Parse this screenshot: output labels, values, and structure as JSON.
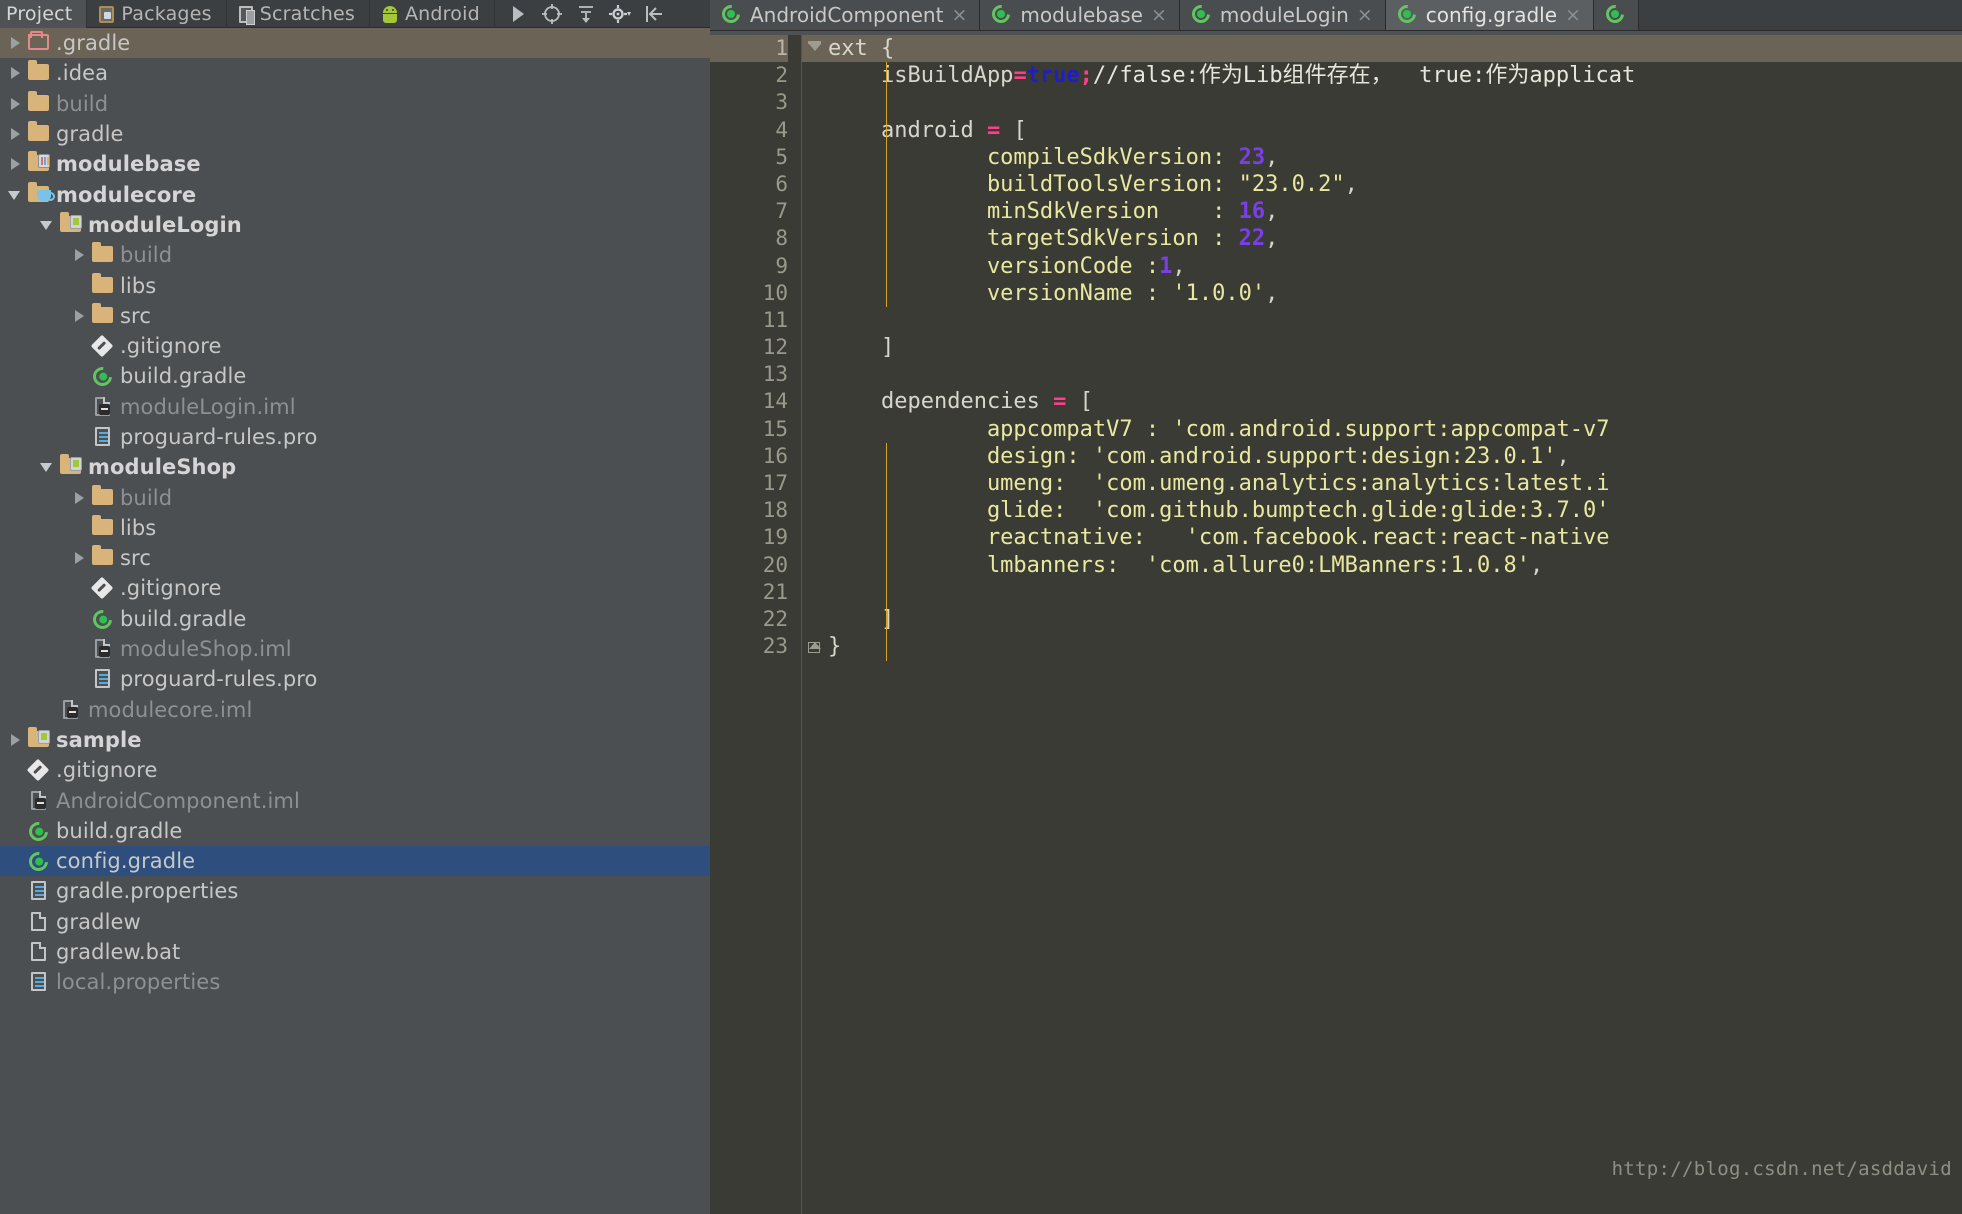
{
  "toolbar": {
    "buttons": [
      {
        "label": "Project",
        "icon": "project-icon",
        "active": true
      },
      {
        "label": "Packages",
        "icon": "packages-icon",
        "active": false
      },
      {
        "label": "Scratches",
        "icon": "scratches-icon",
        "active": false
      },
      {
        "label": "Android",
        "icon": "android-icon",
        "active": false
      }
    ],
    "icons": [
      "play-icon",
      "locate-icon",
      "collapse-all-icon",
      "gear-icon",
      "hide-panel-icon"
    ]
  },
  "tree": {
    "items": [
      {
        "label": ".gradle",
        "indent": 0,
        "arrow": "closed",
        "icon": "folder-hollow-pink",
        "style": "highlight"
      },
      {
        "label": ".idea",
        "indent": 0,
        "arrow": "closed",
        "icon": "folder",
        "style": "normal"
      },
      {
        "label": "build",
        "indent": 0,
        "arrow": "closed",
        "icon": "folder",
        "style": "dim"
      },
      {
        "label": "gradle",
        "indent": 0,
        "arrow": "closed",
        "icon": "folder",
        "style": "normal"
      },
      {
        "label": "modulebase",
        "indent": 0,
        "arrow": "closed",
        "icon": "module-lib",
        "style": "bold"
      },
      {
        "label": "modulecore",
        "indent": 0,
        "arrow": "open",
        "icon": "module-java",
        "style": "bold"
      },
      {
        "label": "moduleLogin",
        "indent": 1,
        "arrow": "open",
        "icon": "module-android",
        "style": "bold"
      },
      {
        "label": "build",
        "indent": 2,
        "arrow": "closed",
        "icon": "folder",
        "style": "dim"
      },
      {
        "label": "libs",
        "indent": 2,
        "arrow": "none",
        "icon": "folder",
        "style": "normal"
      },
      {
        "label": "src",
        "indent": 2,
        "arrow": "closed",
        "icon": "folder",
        "style": "normal"
      },
      {
        "label": ".gitignore",
        "indent": 2,
        "arrow": "none",
        "icon": "git",
        "style": "normal"
      },
      {
        "label": "build.gradle",
        "indent": 2,
        "arrow": "none",
        "icon": "gradle",
        "style": "normal"
      },
      {
        "label": "moduleLogin.iml",
        "indent": 2,
        "arrow": "none",
        "icon": "iml",
        "style": "dim"
      },
      {
        "label": "proguard-rules.pro",
        "indent": 2,
        "arrow": "none",
        "icon": "lines",
        "style": "normal"
      },
      {
        "label": "moduleShop",
        "indent": 1,
        "arrow": "open",
        "icon": "module-android",
        "style": "bold"
      },
      {
        "label": "build",
        "indent": 2,
        "arrow": "closed",
        "icon": "folder",
        "style": "dim"
      },
      {
        "label": "libs",
        "indent": 2,
        "arrow": "none",
        "icon": "folder",
        "style": "normal"
      },
      {
        "label": "src",
        "indent": 2,
        "arrow": "closed",
        "icon": "folder",
        "style": "normal"
      },
      {
        "label": ".gitignore",
        "indent": 2,
        "arrow": "none",
        "icon": "git",
        "style": "normal"
      },
      {
        "label": "build.gradle",
        "indent": 2,
        "arrow": "none",
        "icon": "gradle",
        "style": "normal"
      },
      {
        "label": "moduleShop.iml",
        "indent": 2,
        "arrow": "none",
        "icon": "iml",
        "style": "dim"
      },
      {
        "label": "proguard-rules.pro",
        "indent": 2,
        "arrow": "none",
        "icon": "lines",
        "style": "normal"
      },
      {
        "label": "modulecore.iml",
        "indent": 1,
        "arrow": "none",
        "icon": "iml",
        "style": "dim"
      },
      {
        "label": "sample",
        "indent": 0,
        "arrow": "closed",
        "icon": "module-android",
        "style": "bold"
      },
      {
        "label": ".gitignore",
        "indent": 0,
        "arrow": "none",
        "icon": "git",
        "style": "normal"
      },
      {
        "label": "AndroidComponent.iml",
        "indent": 0,
        "arrow": "none",
        "icon": "iml",
        "style": "dim"
      },
      {
        "label": "build.gradle",
        "indent": 0,
        "arrow": "none",
        "icon": "gradle",
        "style": "normal"
      },
      {
        "label": "config.gradle",
        "indent": 0,
        "arrow": "none",
        "icon": "gradle",
        "style": "selected"
      },
      {
        "label": "gradle.properties",
        "indent": 0,
        "arrow": "none",
        "icon": "lines",
        "style": "normal"
      },
      {
        "label": "gradlew",
        "indent": 0,
        "arrow": "none",
        "icon": "plainfile",
        "style": "normal"
      },
      {
        "label": "gradlew.bat",
        "indent": 0,
        "arrow": "none",
        "icon": "plainfile",
        "style": "normal"
      },
      {
        "label": "local.properties",
        "indent": 0,
        "arrow": "none",
        "icon": "lines",
        "style": "dim"
      }
    ]
  },
  "editor": {
    "tabs": [
      {
        "label": "AndroidComponent",
        "icon": "gradle-icon",
        "active": false,
        "close": "×"
      },
      {
        "label": "modulebase",
        "icon": "gradle-icon",
        "active": false,
        "close": "×"
      },
      {
        "label": "moduleLogin",
        "icon": "gradle-icon",
        "active": false,
        "close": "×"
      },
      {
        "label": "config.gradle",
        "icon": "gradle-icon",
        "active": true,
        "close": "×"
      },
      {
        "label": "",
        "icon": "gradle-icon",
        "active": false,
        "close": ""
      }
    ],
    "lines": [
      {
        "n": "1",
        "fold": "collapse",
        "highlight": true,
        "tokens": [
          {
            "t": "ext ",
            "c": "c-def"
          },
          {
            "t": "{",
            "c": "c-brk"
          }
        ]
      },
      {
        "n": "2",
        "fold": "none",
        "highlight": false,
        "tokens": [
          {
            "t": "    isBuildApp",
            "c": "c-def"
          },
          {
            "t": "=",
            "c": "c-op"
          },
          {
            "t": "true",
            "c": "c-kw"
          },
          {
            "t": ";",
            "c": "c-op"
          },
          {
            "t": "//false:作为Lib组件存在，  true:作为applicat",
            "c": "c-cmt"
          }
        ]
      },
      {
        "n": "3",
        "fold": "none",
        "highlight": false,
        "tokens": []
      },
      {
        "n": "4",
        "fold": "none",
        "highlight": false,
        "tokens": [
          {
            "t": "    android ",
            "c": "c-def"
          },
          {
            "t": "=",
            "c": "c-op"
          },
          {
            "t": " [",
            "c": "c-brk"
          }
        ]
      },
      {
        "n": "5",
        "fold": "none",
        "highlight": false,
        "tokens": [
          {
            "t": "            compileSdkVersion: ",
            "c": "c-key"
          },
          {
            "t": "23",
            "c": "c-num"
          },
          {
            "t": ",",
            "c": "c-brk"
          }
        ]
      },
      {
        "n": "6",
        "fold": "none",
        "highlight": false,
        "tokens": [
          {
            "t": "            buildToolsVersion: ",
            "c": "c-key"
          },
          {
            "t": "\"23.0.2\"",
            "c": "c-str"
          },
          {
            "t": ",",
            "c": "c-brk"
          }
        ]
      },
      {
        "n": "7",
        "fold": "none",
        "highlight": false,
        "tokens": [
          {
            "t": "            minSdkVersion    : ",
            "c": "c-key"
          },
          {
            "t": "16",
            "c": "c-num"
          },
          {
            "t": ",",
            "c": "c-brk"
          }
        ]
      },
      {
        "n": "8",
        "fold": "none",
        "highlight": false,
        "tokens": [
          {
            "t": "            targetSdkVersion : ",
            "c": "c-key"
          },
          {
            "t": "22",
            "c": "c-num"
          },
          {
            "t": ",",
            "c": "c-brk"
          }
        ]
      },
      {
        "n": "9",
        "fold": "none",
        "highlight": false,
        "tokens": [
          {
            "t": "            versionCode :",
            "c": "c-key"
          },
          {
            "t": "1",
            "c": "c-num"
          },
          {
            "t": ",",
            "c": "c-brk"
          }
        ]
      },
      {
        "n": "10",
        "fold": "none",
        "highlight": false,
        "tokens": [
          {
            "t": "            versionName : ",
            "c": "c-key"
          },
          {
            "t": "'1.0.0'",
            "c": "c-str"
          },
          {
            "t": ",",
            "c": "c-brk"
          }
        ]
      },
      {
        "n": "11",
        "fold": "none",
        "highlight": false,
        "tokens": []
      },
      {
        "n": "12",
        "fold": "none",
        "highlight": false,
        "tokens": [
          {
            "t": "    ]",
            "c": "c-brk"
          }
        ]
      },
      {
        "n": "13",
        "fold": "none",
        "highlight": false,
        "tokens": []
      },
      {
        "n": "14",
        "fold": "none",
        "highlight": false,
        "tokens": [
          {
            "t": "    dependencies ",
            "c": "c-def"
          },
          {
            "t": "=",
            "c": "c-op"
          },
          {
            "t": " [",
            "c": "c-brk"
          }
        ]
      },
      {
        "n": "15",
        "fold": "none",
        "highlight": false,
        "tokens": [
          {
            "t": "            appcompatV7 : ",
            "c": "c-key"
          },
          {
            "t": "'com.android.support:appcompat-v7",
            "c": "c-str"
          }
        ]
      },
      {
        "n": "16",
        "fold": "none",
        "highlight": false,
        "tokens": [
          {
            "t": "            design: ",
            "c": "c-key"
          },
          {
            "t": "'com.android.support:design:23.0.1'",
            "c": "c-str"
          },
          {
            "t": ",",
            "c": "c-brk"
          }
        ]
      },
      {
        "n": "17",
        "fold": "none",
        "highlight": false,
        "tokens": [
          {
            "t": "            umeng:  ",
            "c": "c-key"
          },
          {
            "t": "'com.umeng.analytics:analytics:latest.i",
            "c": "c-str"
          }
        ]
      },
      {
        "n": "18",
        "fold": "none",
        "highlight": false,
        "tokens": [
          {
            "t": "            glide:  ",
            "c": "c-key"
          },
          {
            "t": "'com.github.bumptech.glide:glide:3.7.0'",
            "c": "c-str"
          }
        ]
      },
      {
        "n": "19",
        "fold": "none",
        "highlight": false,
        "tokens": [
          {
            "t": "            reactnative:   ",
            "c": "c-key"
          },
          {
            "t": "'com.facebook.react:react-native",
            "c": "c-str"
          }
        ]
      },
      {
        "n": "20",
        "fold": "none",
        "highlight": false,
        "tokens": [
          {
            "t": "            lmbanners:  ",
            "c": "c-key"
          },
          {
            "t": "'com.allure0:LMBanners:1.0.8'",
            "c": "c-str"
          },
          {
            "t": ",",
            "c": "c-brk"
          }
        ]
      },
      {
        "n": "21",
        "fold": "none",
        "highlight": false,
        "tokens": []
      },
      {
        "n": "22",
        "fold": "none",
        "highlight": false,
        "tokens": [
          {
            "t": "    ]",
            "c": "c-brk"
          }
        ]
      },
      {
        "n": "23",
        "fold": "expand",
        "highlight": false,
        "tokens": [
          {
            "t": "}",
            "c": "c-brk"
          }
        ]
      }
    ]
  },
  "watermark": "http://blog.csdn.net/asddavid"
}
